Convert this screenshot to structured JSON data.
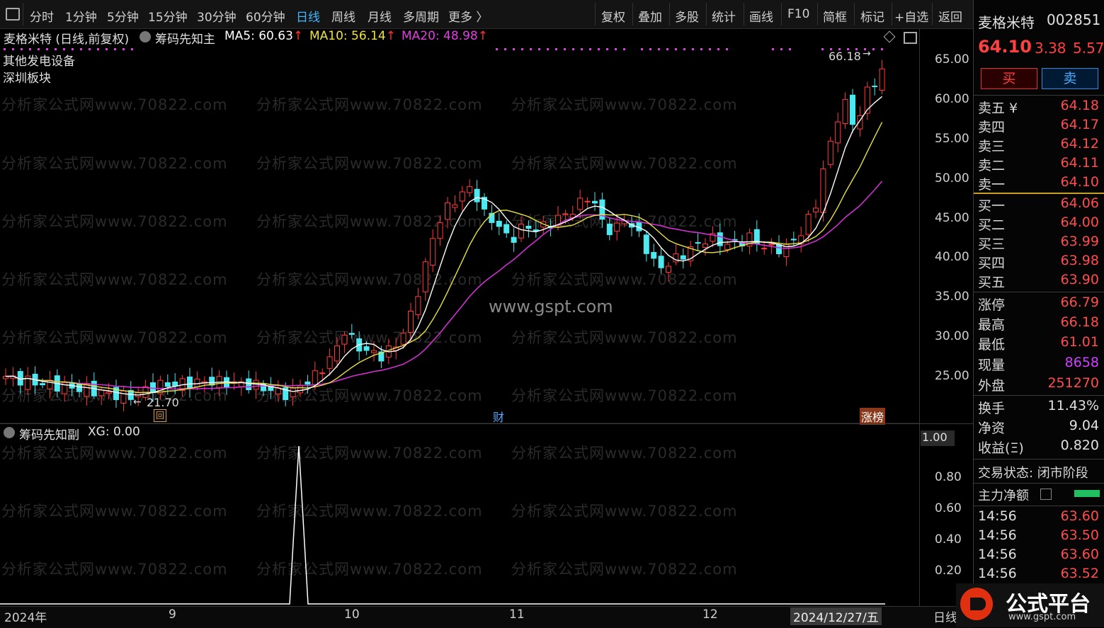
{
  "toolbar": {
    "periods": [
      "分时",
      "1分钟",
      "5分钟",
      "15分钟",
      "30分钟",
      "60分钟",
      "日线",
      "周线",
      "月线",
      "多周期",
      "更多 〉"
    ],
    "active": "日线",
    "tools": [
      "复权",
      "叠加",
      "多股",
      "统计",
      "画线",
      "F10",
      "简框",
      "标记",
      "+自选",
      "返回"
    ]
  },
  "header": {
    "title": "麦格米特 (日线,前复权)",
    "indicator": "筹码先知主",
    "ma5": "MA5: 60.63",
    "ma10": "MA10: 56.14",
    "ma20": "MA20: 48.98",
    "sector1": "其他发电设备",
    "sector2": "深圳板块"
  },
  "chart": {
    "price_axis": [
      "65.00",
      "60.00",
      "55.00",
      "50.00",
      "45.00",
      "40.00",
      "35.00",
      "30.00",
      "25.00"
    ],
    "high_label": "66.18",
    "low_label": "21.70",
    "marker_hui": "回",
    "marker_cai": "财",
    "marker_zhangbang": "涨榜",
    "watermark": "分析家公式网www.70822.com",
    "site": "www.gspt.com"
  },
  "chart_data": {
    "type": "candlestick",
    "title": "麦格米特 (日线,前复权)",
    "series": [
      {
        "name": "MA5",
        "last": 60.63
      },
      {
        "name": "MA10",
        "last": 56.14
      },
      {
        "name": "MA20",
        "last": 48.98
      }
    ],
    "price_range": [
      21.7,
      66.18
    ],
    "high": 66.18,
    "low": 21.7,
    "x_labels": [
      "2024年",
      "9",
      "10",
      "11",
      "12"
    ]
  },
  "sub": {
    "title": "筹码先知副",
    "xg": "XG: 0.00",
    "axis": [
      "1.00",
      "0.80",
      "0.60",
      "0.40",
      "0.20"
    ],
    "spike_value": 1.0
  },
  "xaxis": {
    "labels": [
      "2024年",
      "9",
      "10",
      "11",
      "12"
    ],
    "cursor_date": "2024/12/27/五",
    "period": "日线"
  },
  "quote": {
    "name": "麦格米特",
    "code": "002851",
    "price": "64.10",
    "change": "3.38",
    "pct": "5.57",
    "buy": "买",
    "sell": "卖",
    "asks": [
      {
        "label": "卖五 ¥",
        "price": "64.18"
      },
      {
        "label": "卖四",
        "price": "64.17"
      },
      {
        "label": "卖三",
        "price": "64.12"
      },
      {
        "label": "卖二",
        "price": "64.11"
      },
      {
        "label": "卖一",
        "price": "64.10"
      }
    ],
    "bids": [
      {
        "label": "买一",
        "price": "64.06"
      },
      {
        "label": "买二",
        "price": "64.00"
      },
      {
        "label": "买三",
        "price": "63.99"
      },
      {
        "label": "买四",
        "price": "63.98"
      },
      {
        "label": "买五",
        "price": "63.90"
      }
    ],
    "stats": [
      {
        "label": "涨停",
        "value": "66.79"
      },
      {
        "label": "最高",
        "value": "66.18"
      },
      {
        "label": "最低",
        "value": "61.01"
      },
      {
        "label": "现量",
        "value": "8658"
      },
      {
        "label": "外盘",
        "value": "251270"
      }
    ],
    "stats2": [
      {
        "label": "换手",
        "value": "11.43%"
      },
      {
        "label": "净资",
        "value": "9.04"
      },
      {
        "label": "收益(Ξ)",
        "value": "0.820"
      }
    ],
    "status": "交易状态: 闭市阶段",
    "main_net": "主力净额",
    "ticks": [
      {
        "time": "14:56",
        "price": "63.60"
      },
      {
        "time": "14:56",
        "price": "63.50"
      },
      {
        "time": "14:56",
        "price": "63.60"
      },
      {
        "time": "14:56",
        "price": "63.52"
      }
    ]
  },
  "logo": {
    "text": "公式平台",
    "url": "www.gspt.com"
  }
}
